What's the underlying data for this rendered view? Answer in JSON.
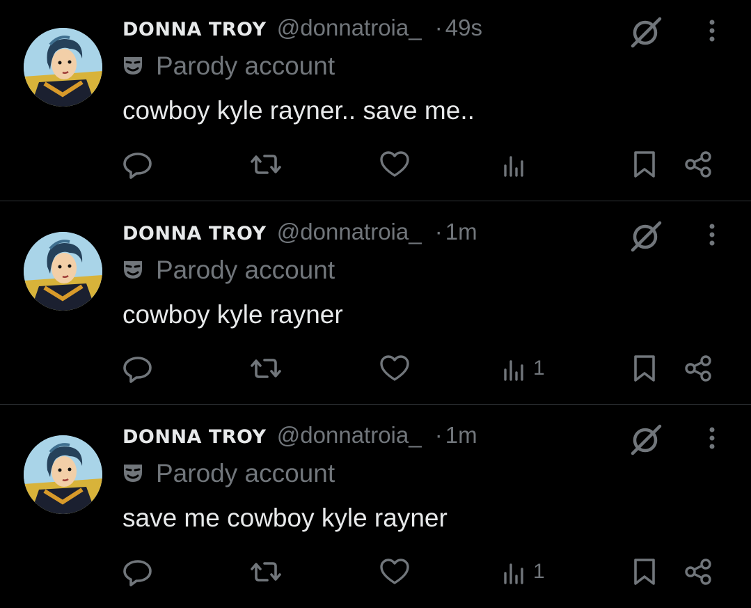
{
  "tweets": [
    {
      "name": "DONNA TROY",
      "handle": "@donnatroia_",
      "separator": "·",
      "time": "49s",
      "label": "Parody account",
      "text": "cowboy kyle rayner.. save me..",
      "views": ""
    },
    {
      "name": "DONNA TROY",
      "handle": "@donnatroia_",
      "separator": "·",
      "time": "1m",
      "label": "Parody account",
      "text": "cowboy kyle rayner",
      "views": "1"
    },
    {
      "name": "DONNA TROY",
      "handle": "@donnatroia_",
      "separator": "·",
      "time": "1m",
      "label": "Parody account",
      "text": "save me cowboy kyle rayner",
      "views": "1"
    }
  ],
  "icons": {
    "reply": "reply-icon",
    "retweet": "retweet-icon",
    "like": "heart-icon",
    "views": "views-icon",
    "bookmark": "bookmark-icon",
    "share": "share-icon",
    "grok": "grok-icon",
    "more": "more-icon",
    "parody": "theater-mask-icon"
  },
  "colors": {
    "background": "#000000",
    "primary_text": "#e7e9ea",
    "secondary_text": "#71767b",
    "divider": "#2f3336"
  }
}
